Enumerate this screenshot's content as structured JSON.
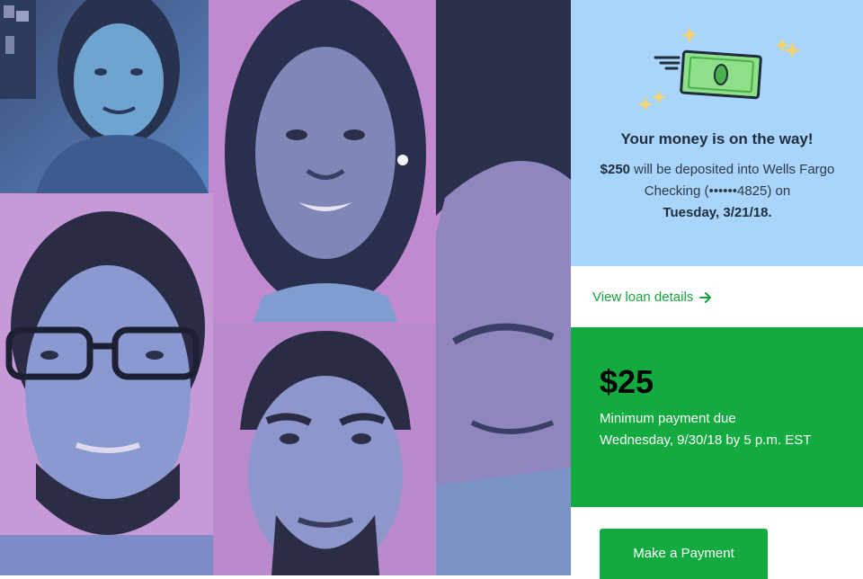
{
  "collage": {
    "photos": [
      {
        "name": "photo-woman-office"
      },
      {
        "name": "photo-woman-smiling"
      },
      {
        "name": "photo-man-closeup"
      },
      {
        "name": "photo-man-glasses"
      },
      {
        "name": "photo-man-beard"
      }
    ],
    "colors": {
      "pink": "#c58ccf",
      "blue": "#6aa8d4",
      "dark": "#2b3a5c"
    }
  },
  "confirmation": {
    "icon": "money-bill-icon",
    "title": "Your money is on the way!",
    "amount": "$250",
    "body_part1": " will be deposited into Wells Fargo Checking (••••••4825) on",
    "date": "Tuesday, 3/21/18."
  },
  "loan_link": {
    "label": "View loan details",
    "icon": "arrow-right-icon"
  },
  "payment_due": {
    "amount": "$25",
    "label": "Minimum payment due",
    "deadline": "Wednesday, 9/30/18 by 5 p.m. EST"
  },
  "actions": {
    "make_payment_label": "Make a Payment"
  },
  "theme": {
    "confirm_bg": "#a9d4fb",
    "brand_green": "#13aa3f",
    "link_green": "#16a33c"
  }
}
